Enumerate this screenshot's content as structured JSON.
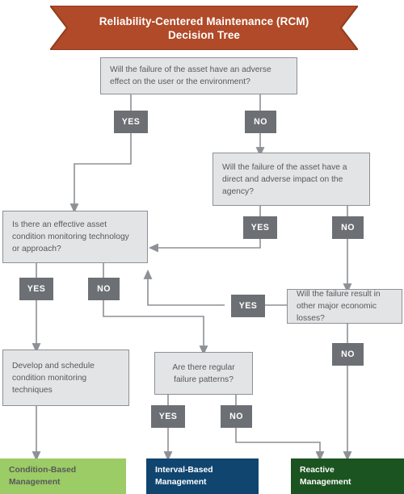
{
  "banner": {
    "line1": "Reliability-Centered Maintenance (RCM)",
    "line2": "Decision Tree",
    "fill": "#b04a28",
    "stroke": "#8f3c1f"
  },
  "nodes": {
    "q1": "Will the failure of the asset have an adverse effect on the user or the environment?",
    "q2": "Will the failure of the asset have a direct and adverse impact on the agency?",
    "q3": "Is there an effective asset condition monitoring technology or approach?",
    "q4": "Will the failure result in other major economic losses?",
    "q5": "Are there regular failure patterns?",
    "action1": "Develop and schedule condition monitoring techniques"
  },
  "chips": {
    "q1_yes": "YES",
    "q1_no": "NO",
    "q2_yes": "YES",
    "q2_no": "NO",
    "q3_yes": "YES",
    "q3_no": "NO",
    "q4_yes": "YES",
    "q4_no": "NO",
    "q5_yes": "YES",
    "q5_no": "NO"
  },
  "outcomes": {
    "condition_based": {
      "line1": "Condition-Based",
      "line2": "Management",
      "color": "#9ccc65"
    },
    "interval_based": {
      "line1": "Interval-Based",
      "line2": "Management",
      "color": "#10456f"
    },
    "reactive": {
      "line1": "Reactive",
      "line2": "Management",
      "color": "#1b5420"
    }
  },
  "style": {
    "connector_color": "#8d9095",
    "node_fill": "#e3e4e6",
    "node_stroke": "#8d9095",
    "chip_fill": "#6c7075",
    "text_color": "#58595b"
  }
}
